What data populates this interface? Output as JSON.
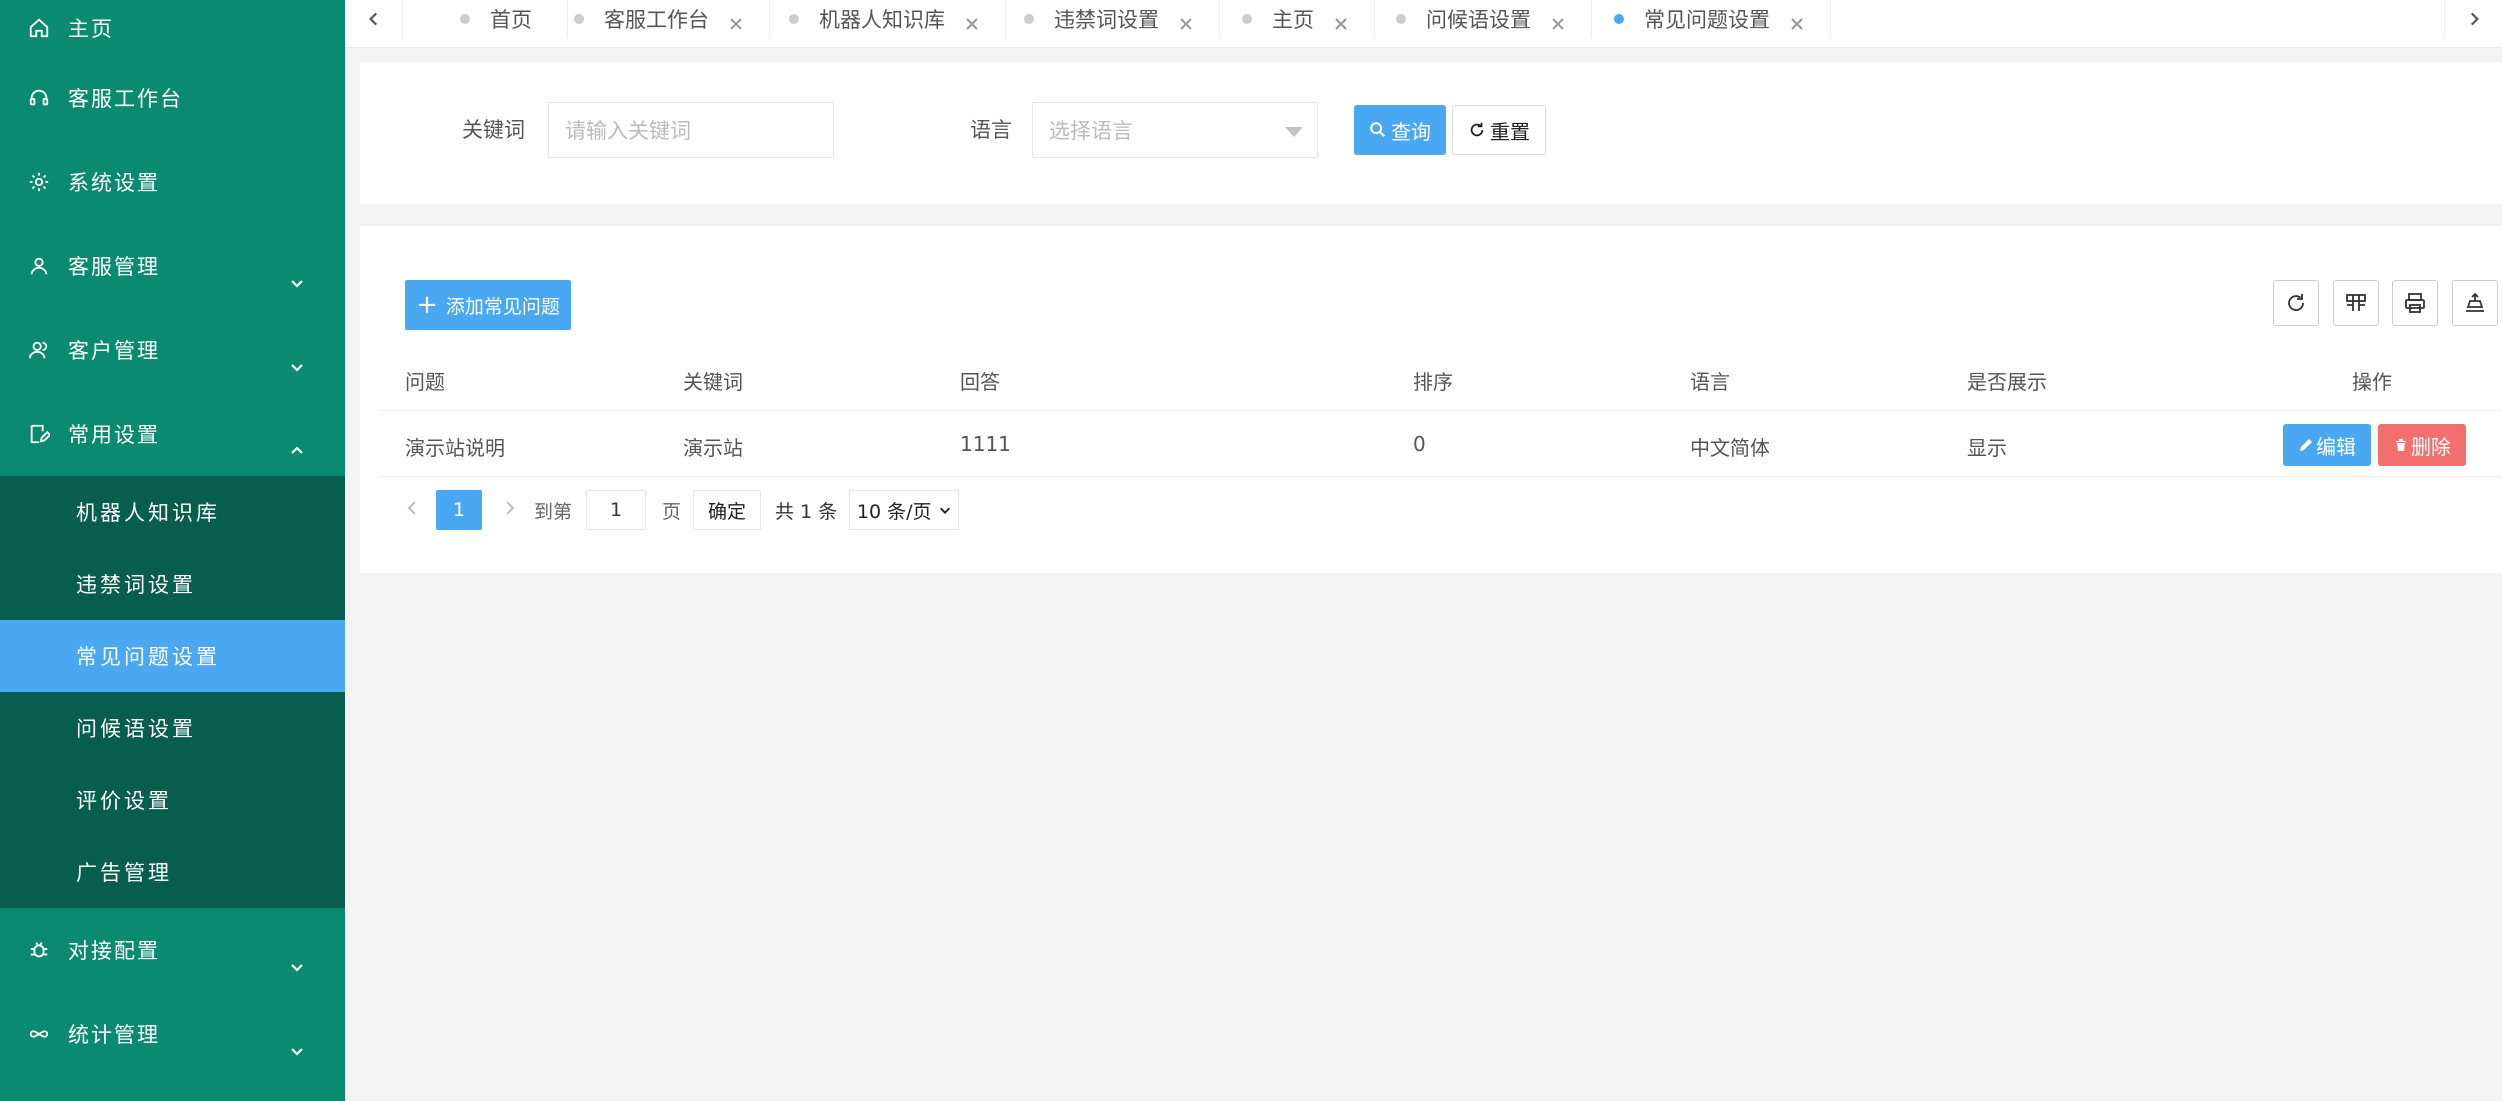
{
  "sidebar": {
    "menu": [
      {
        "label": "主页",
        "icon": "home-icon",
        "expandable": false
      },
      {
        "label": "客服工作台",
        "icon": "headset-icon",
        "expandable": false
      },
      {
        "label": "系统设置",
        "icon": "gear-icon",
        "expandable": false
      },
      {
        "label": "客服管理",
        "icon": "user-icon",
        "expandable": true
      },
      {
        "label": "客户管理",
        "icon": "users-icon",
        "expandable": true
      },
      {
        "label": "常用设置",
        "icon": "edit-icon",
        "expandable": true,
        "expanded": true
      }
    ],
    "submenu": [
      {
        "label": "机器人知识库"
      },
      {
        "label": "违禁词设置"
      },
      {
        "label": "常见问题设置",
        "active": true
      },
      {
        "label": "问候语设置"
      },
      {
        "label": "评价设置"
      },
      {
        "label": "广告管理"
      }
    ],
    "menu_after": [
      {
        "label": "对接配置",
        "icon": "bug-icon",
        "expandable": true
      },
      {
        "label": "统计管理",
        "icon": "infinity-icon",
        "expandable": true
      }
    ]
  },
  "tabs": [
    {
      "label": "首页",
      "closable": false
    },
    {
      "label": "客服工作台",
      "closable": true
    },
    {
      "label": "机器人知识库",
      "closable": true
    },
    {
      "label": "违禁词设置",
      "closable": true
    },
    {
      "label": "主页",
      "closable": true
    },
    {
      "label": "问候语设置",
      "closable": true
    },
    {
      "label": "常见问题设置",
      "closable": true,
      "active": true
    }
  ],
  "search": {
    "keyword_label": "关键词",
    "keyword_placeholder": "请输入关键词",
    "language_label": "语言",
    "language_placeholder": "选择语言",
    "query_button": "查询",
    "reset_button": "重置"
  },
  "table": {
    "add_button": "添加常见问题",
    "columns": [
      "问题",
      "关键词",
      "回答",
      "排序",
      "语言",
      "是否展示",
      "操作"
    ],
    "rows": [
      {
        "question": "演示站说明",
        "keyword": "演示站",
        "answer": "1111",
        "sort": "0",
        "language": "中文简体",
        "display": "显示"
      }
    ],
    "edit_button": "编辑",
    "delete_button": "删除"
  },
  "pagination": {
    "current_page": "1",
    "goto_label": "到第",
    "goto_value": "1",
    "page_label": "页",
    "confirm": "确定",
    "total": "共 1 条",
    "page_size": "10 条/页"
  },
  "colors": {
    "sidebar": "#0b8a72",
    "submenu": "#075e4e",
    "primary": "#49a8f1",
    "danger": "#f26f6f"
  }
}
